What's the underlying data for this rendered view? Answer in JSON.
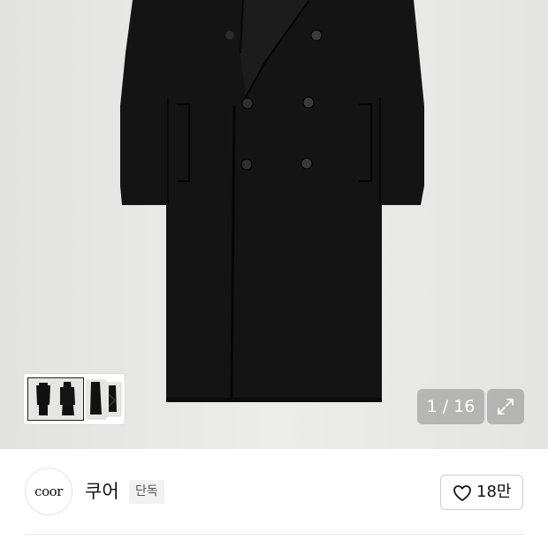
{
  "gallery": {
    "counter": "1 / 16",
    "current_page": 1,
    "total_pages": 16,
    "expand_icon": "expand-arrows-icon",
    "next_icon": "chevron-right-icon"
  },
  "seller": {
    "logo_text": "coor",
    "name": "쿠어",
    "badge": "단독"
  },
  "like": {
    "icon": "heart-outline-icon",
    "count": "18만"
  },
  "colors": {
    "photo_bg": "#e8e8e6",
    "coat": "#141414",
    "overlay": "rgba(140,140,140,0.55)",
    "badge_bg": "#f1f1f1",
    "divider": "#e6e6e6"
  }
}
